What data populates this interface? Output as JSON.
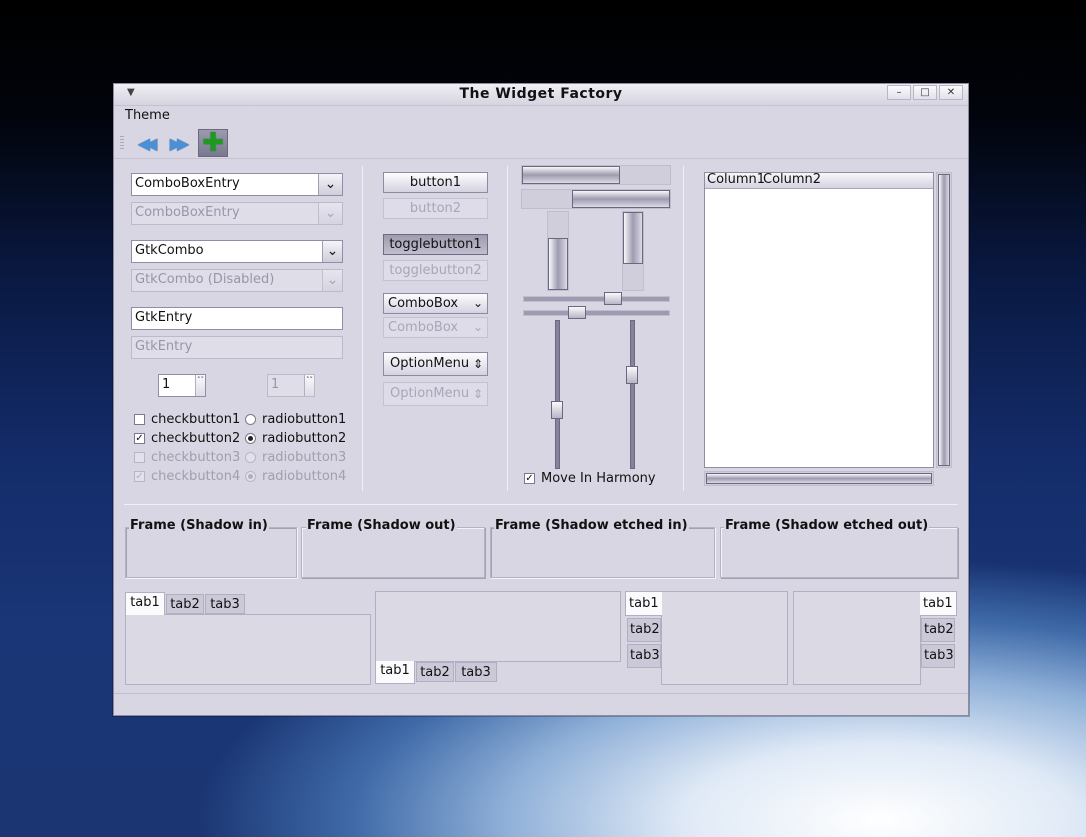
{
  "window": {
    "title": "The Widget Factory",
    "minimize_glyph": "–",
    "maximize_glyph": "□",
    "close_glyph": "✕",
    "window_menu_glyph": "▼"
  },
  "menubar": {
    "theme_label": "Theme"
  },
  "toolbar": {
    "back_icon": "rewind-icon",
    "forward_icon": "fast-forward-icon",
    "add_icon": "add-icon",
    "back_glyph": "◀◀",
    "forward_glyph": "▶▶",
    "add_glyph": "✚"
  },
  "left": {
    "combobox_entry": "ComboBoxEntry",
    "combobox_entry_disabled": "ComboBoxEntry",
    "gtkcombo": "GtkCombo",
    "gtkcombo_disabled": "GtkCombo (Disabled)",
    "entry": "GtkEntry",
    "entry_disabled": "GtkEntry",
    "spin_value": "1",
    "spin_disabled_value": "1",
    "spin_arrows": "˄˅",
    "dropdown_glyph": "⌄",
    "check_mark": "✓",
    "checkbuttons": [
      "checkbutton1",
      "checkbutton2",
      "checkbutton3",
      "checkbutton4"
    ],
    "radiobuttons": [
      "radiobutton1",
      "radiobutton2",
      "radiobutton3",
      "radiobutton4"
    ]
  },
  "middle": {
    "button1": "button1",
    "button2": "button2",
    "togglebutton1": "togglebutton1",
    "togglebutton2": "togglebutton2",
    "combobox": "ComboBox",
    "combobox_disabled": "ComboBox",
    "optionmenu": "OptionMenu",
    "optionmenu_disabled": "OptionMenu",
    "optionmenu_glyph": "⇕"
  },
  "sliders": {
    "move_in_harmony": "Move In Harmony",
    "move_in_harmony_checked": true,
    "hscale1_value": 0.63,
    "hscale2_value": 0.35,
    "vscale1_value": 0.62,
    "vscale2_value": 0.35
  },
  "tree": {
    "columns": [
      "Column1",
      "Column2"
    ]
  },
  "frames": [
    "Frame (Shadow in)",
    "Frame (Shadow out)",
    "Frame (Shadow etched in)",
    "Frame (Shadow etched out)"
  ],
  "notebooks": {
    "tabs": [
      "tab1",
      "tab2",
      "tab3"
    ]
  }
}
